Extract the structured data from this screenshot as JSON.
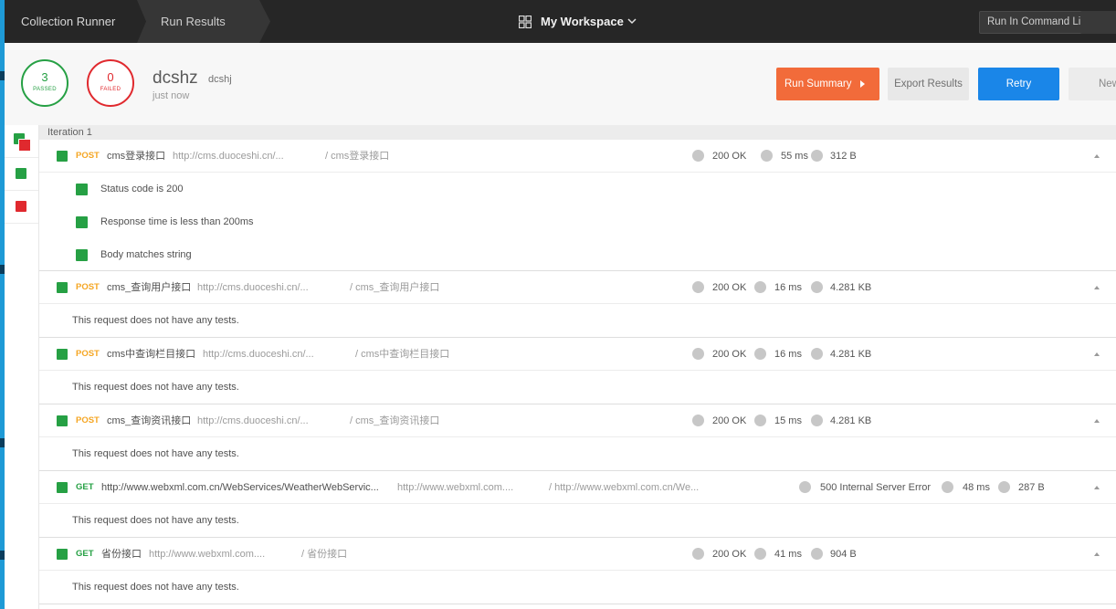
{
  "topbar": {
    "crumb_home": "Collection Runner",
    "crumb_current": "Run Results",
    "workspace": "My Workspace",
    "run_cli_label": "Run In Command Line"
  },
  "summary": {
    "passed_count": "3",
    "passed_label": "PASSED",
    "failed_count": "0",
    "failed_label": "FAILED",
    "run_name": "dcshz",
    "environment": "dcshj",
    "time": "just now",
    "run_summary_label": "Run Summary",
    "export_label": "Export Results",
    "retry_label": "Retry",
    "new_label": "New"
  },
  "iteration_label": "Iteration 1",
  "requests": [
    {
      "method": "POST",
      "name": "cms登录接口",
      "url": "http://cms.duoceshi.cn/...",
      "path": "/ cms登录接口",
      "status": "200 OK",
      "time": "55 ms",
      "size": "312 B",
      "tests": [
        "Status code is 200",
        "Response time is less than 200ms",
        "Body matches string"
      ]
    },
    {
      "method": "POST",
      "name": "cms_查询用户接口",
      "url": "http://cms.duoceshi.cn/...",
      "path": "/ cms_查询用户接口",
      "status": "200 OK",
      "time": "16 ms",
      "size": "4.281 KB",
      "no_tests": "This request does not have any tests."
    },
    {
      "method": "POST",
      "name": "cms中查询栏目接口",
      "url": "http://cms.duoceshi.cn/...",
      "path": "/ cms中查询栏目接口",
      "status": "200 OK",
      "time": "16 ms",
      "size": "4.281 KB",
      "no_tests": "This request does not have any tests."
    },
    {
      "method": "POST",
      "name": "cms_查询资讯接口",
      "url": "http://cms.duoceshi.cn/...",
      "path": "/ cms_查询资讯接口",
      "status": "200 OK",
      "time": "15 ms",
      "size": "4.281 KB",
      "no_tests": "This request does not have any tests."
    },
    {
      "method": "GET",
      "name": "http://www.webxml.com.cn/WebServices/WeatherWebServic...",
      "url": "http://www.webxml.com....",
      "path": "/ http://www.webxml.com.cn/We...",
      "status": "500 Internal Server Error",
      "time": "48 ms",
      "size": "287 B",
      "no_tests": "This request does not have any tests."
    },
    {
      "method": "GET",
      "name": "省份接口",
      "url": "http://www.webxml.com....",
      "path": "/ 省份接口",
      "status": "200 OK",
      "time": "41 ms",
      "size": "904 B",
      "no_tests": "This request does not have any tests."
    }
  ],
  "icons": {
    "grid": "workspace-grid-icon",
    "chevron": "chevron-down-icon",
    "caret": "caret-right-icon",
    "collapse": "collapse-caret-icon"
  },
  "colors": {
    "pass": "#26a044",
    "fail": "#e0292e",
    "post": "#f5a623",
    "accent_orange": "#f26b3a",
    "accent_blue": "#1a86e8"
  }
}
